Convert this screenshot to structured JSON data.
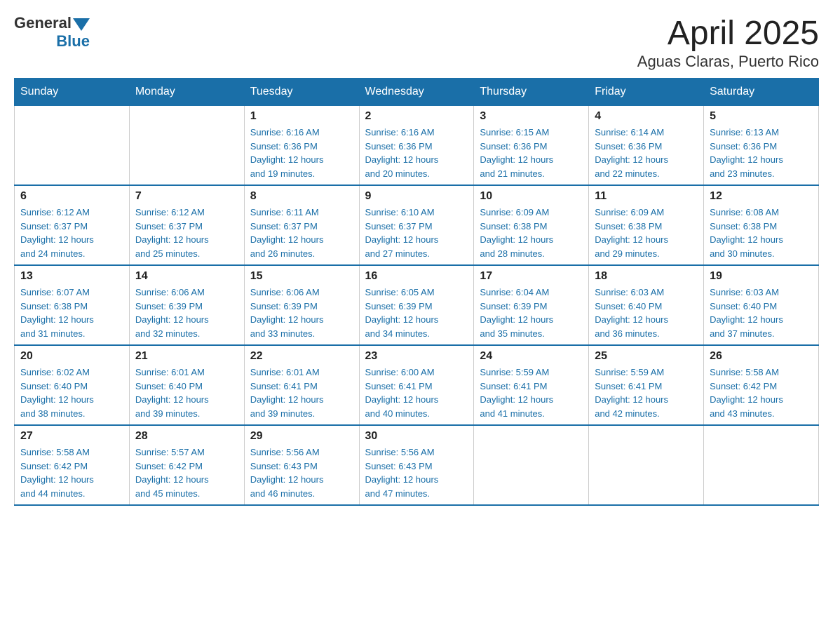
{
  "logo": {
    "general": "General",
    "blue": "Blue"
  },
  "title": "April 2025",
  "subtitle": "Aguas Claras, Puerto Rico",
  "weekdays": [
    "Sunday",
    "Monday",
    "Tuesday",
    "Wednesday",
    "Thursday",
    "Friday",
    "Saturday"
  ],
  "weeks": [
    [
      {
        "day": "",
        "info": ""
      },
      {
        "day": "",
        "info": ""
      },
      {
        "day": "1",
        "info": "Sunrise: 6:16 AM\nSunset: 6:36 PM\nDaylight: 12 hours\nand 19 minutes."
      },
      {
        "day": "2",
        "info": "Sunrise: 6:16 AM\nSunset: 6:36 PM\nDaylight: 12 hours\nand 20 minutes."
      },
      {
        "day": "3",
        "info": "Sunrise: 6:15 AM\nSunset: 6:36 PM\nDaylight: 12 hours\nand 21 minutes."
      },
      {
        "day": "4",
        "info": "Sunrise: 6:14 AM\nSunset: 6:36 PM\nDaylight: 12 hours\nand 22 minutes."
      },
      {
        "day": "5",
        "info": "Sunrise: 6:13 AM\nSunset: 6:36 PM\nDaylight: 12 hours\nand 23 minutes."
      }
    ],
    [
      {
        "day": "6",
        "info": "Sunrise: 6:12 AM\nSunset: 6:37 PM\nDaylight: 12 hours\nand 24 minutes."
      },
      {
        "day": "7",
        "info": "Sunrise: 6:12 AM\nSunset: 6:37 PM\nDaylight: 12 hours\nand 25 minutes."
      },
      {
        "day": "8",
        "info": "Sunrise: 6:11 AM\nSunset: 6:37 PM\nDaylight: 12 hours\nand 26 minutes."
      },
      {
        "day": "9",
        "info": "Sunrise: 6:10 AM\nSunset: 6:37 PM\nDaylight: 12 hours\nand 27 minutes."
      },
      {
        "day": "10",
        "info": "Sunrise: 6:09 AM\nSunset: 6:38 PM\nDaylight: 12 hours\nand 28 minutes."
      },
      {
        "day": "11",
        "info": "Sunrise: 6:09 AM\nSunset: 6:38 PM\nDaylight: 12 hours\nand 29 minutes."
      },
      {
        "day": "12",
        "info": "Sunrise: 6:08 AM\nSunset: 6:38 PM\nDaylight: 12 hours\nand 30 minutes."
      }
    ],
    [
      {
        "day": "13",
        "info": "Sunrise: 6:07 AM\nSunset: 6:38 PM\nDaylight: 12 hours\nand 31 minutes."
      },
      {
        "day": "14",
        "info": "Sunrise: 6:06 AM\nSunset: 6:39 PM\nDaylight: 12 hours\nand 32 minutes."
      },
      {
        "day": "15",
        "info": "Sunrise: 6:06 AM\nSunset: 6:39 PM\nDaylight: 12 hours\nand 33 minutes."
      },
      {
        "day": "16",
        "info": "Sunrise: 6:05 AM\nSunset: 6:39 PM\nDaylight: 12 hours\nand 34 minutes."
      },
      {
        "day": "17",
        "info": "Sunrise: 6:04 AM\nSunset: 6:39 PM\nDaylight: 12 hours\nand 35 minutes."
      },
      {
        "day": "18",
        "info": "Sunrise: 6:03 AM\nSunset: 6:40 PM\nDaylight: 12 hours\nand 36 minutes."
      },
      {
        "day": "19",
        "info": "Sunrise: 6:03 AM\nSunset: 6:40 PM\nDaylight: 12 hours\nand 37 minutes."
      }
    ],
    [
      {
        "day": "20",
        "info": "Sunrise: 6:02 AM\nSunset: 6:40 PM\nDaylight: 12 hours\nand 38 minutes."
      },
      {
        "day": "21",
        "info": "Sunrise: 6:01 AM\nSunset: 6:40 PM\nDaylight: 12 hours\nand 39 minutes."
      },
      {
        "day": "22",
        "info": "Sunrise: 6:01 AM\nSunset: 6:41 PM\nDaylight: 12 hours\nand 39 minutes."
      },
      {
        "day": "23",
        "info": "Sunrise: 6:00 AM\nSunset: 6:41 PM\nDaylight: 12 hours\nand 40 minutes."
      },
      {
        "day": "24",
        "info": "Sunrise: 5:59 AM\nSunset: 6:41 PM\nDaylight: 12 hours\nand 41 minutes."
      },
      {
        "day": "25",
        "info": "Sunrise: 5:59 AM\nSunset: 6:41 PM\nDaylight: 12 hours\nand 42 minutes."
      },
      {
        "day": "26",
        "info": "Sunrise: 5:58 AM\nSunset: 6:42 PM\nDaylight: 12 hours\nand 43 minutes."
      }
    ],
    [
      {
        "day": "27",
        "info": "Sunrise: 5:58 AM\nSunset: 6:42 PM\nDaylight: 12 hours\nand 44 minutes."
      },
      {
        "day": "28",
        "info": "Sunrise: 5:57 AM\nSunset: 6:42 PM\nDaylight: 12 hours\nand 45 minutes."
      },
      {
        "day": "29",
        "info": "Sunrise: 5:56 AM\nSunset: 6:43 PM\nDaylight: 12 hours\nand 46 minutes."
      },
      {
        "day": "30",
        "info": "Sunrise: 5:56 AM\nSunset: 6:43 PM\nDaylight: 12 hours\nand 47 minutes."
      },
      {
        "day": "",
        "info": ""
      },
      {
        "day": "",
        "info": ""
      },
      {
        "day": "",
        "info": ""
      }
    ]
  ]
}
